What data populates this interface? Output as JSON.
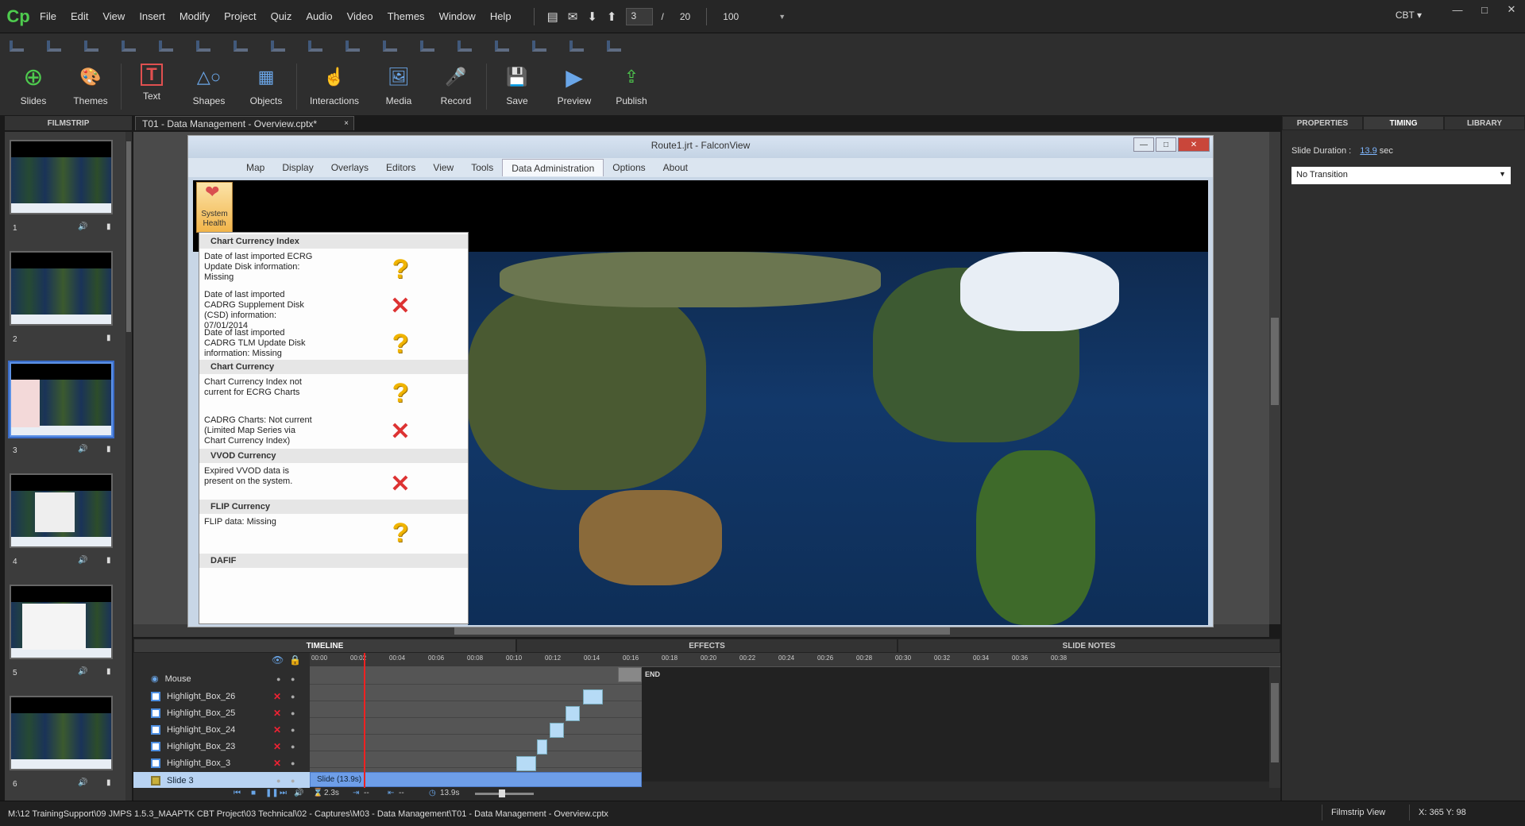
{
  "menubar": {
    "logo": "Cp",
    "items": [
      "File",
      "Edit",
      "View",
      "Insert",
      "Modify",
      "Project",
      "Quiz",
      "Audio",
      "Video",
      "Themes",
      "Window",
      "Help"
    ],
    "current_slide": "3",
    "slide_sep": "/",
    "total_slides": "20",
    "zoom": "100",
    "workspace": "CBT"
  },
  "ribbon": {
    "buttons": [
      {
        "label": "Slides",
        "icon": "plus-circle-icon"
      },
      {
        "label": "Themes",
        "icon": "palette-icon"
      },
      {
        "label": "Text",
        "icon": "text-t-icon"
      },
      {
        "label": "Shapes",
        "icon": "shapes-icon"
      },
      {
        "label": "Objects",
        "icon": "objects-icon"
      },
      {
        "label": "Interactions",
        "icon": "hand-pointer-icon"
      },
      {
        "label": "Media",
        "icon": "image-icon"
      },
      {
        "label": "Record",
        "icon": "microphone-icon"
      },
      {
        "label": "Save",
        "icon": "floppy-icon"
      },
      {
        "label": "Preview",
        "icon": "play-icon"
      },
      {
        "label": "Publish",
        "icon": "publish-icon"
      }
    ]
  },
  "filmstrip": {
    "header": "FILMSTRIP",
    "slides": [
      "1",
      "2",
      "3",
      "4",
      "5",
      "6"
    ]
  },
  "document_tab": {
    "title": "T01 - Data Management - Overview.cptx*",
    "close": "×"
  },
  "falconview": {
    "title": "Route1.jrt - FalconView",
    "tabs": [
      "Map",
      "Display",
      "Overlays",
      "Editors",
      "View",
      "Tools",
      "Data Administration",
      "Options",
      "About"
    ],
    "active_tab": "Data Administration",
    "system_health_label": "System Health",
    "popup": {
      "sections": [
        {
          "title": "Chart Currency Index"
        },
        {
          "title": "Chart Currency"
        },
        {
          "title": "VVOD Currency"
        },
        {
          "title": "FLIP Currency"
        },
        {
          "title": "DAFIF"
        }
      ],
      "items": [
        {
          "text": "Date of last imported ECRG Update Disk information: Missing",
          "status": "?"
        },
        {
          "text": "Date of last imported CADRG Supplement Disk (CSD) information:  07/01/2014",
          "status": "✕"
        },
        {
          "text": "Date of last imported CADRG TLM Update Disk information: Missing",
          "status": "?"
        },
        {
          "text": "Chart Currency Index not current for ECRG Charts",
          "status": "?"
        },
        {
          "text": "CADRG Charts: Not current (Limited Map Series via Chart Currency Index)",
          "status": "✕"
        },
        {
          "text": "Expired VVOD data is present on the system.",
          "status": "✕"
        },
        {
          "text": "FLIP data:  Missing",
          "status": "?"
        }
      ]
    }
  },
  "properties": {
    "tabs": [
      "PROPERTIES",
      "TIMING",
      "LIBRARY"
    ],
    "duration_label": "Slide Duration :",
    "duration_value": "13.9",
    "duration_unit": "sec",
    "transition": "No Transition"
  },
  "timeline": {
    "tabs": [
      "TIMELINE",
      "EFFECTS",
      "SLIDE NOTES"
    ],
    "rows": [
      {
        "name": "Mouse"
      },
      {
        "name": "Highlight_Box_26"
      },
      {
        "name": "Highlight_Box_25"
      },
      {
        "name": "Highlight_Box_24"
      },
      {
        "name": "Highlight_Box_23"
      },
      {
        "name": "Highlight_Box_3"
      },
      {
        "name": "Slide 3"
      }
    ],
    "ruler": [
      "00:00",
      "00:02",
      "00:04",
      "00:06",
      "00:08",
      "00:10",
      "00:12",
      "00:14",
      "00:16",
      "00:18",
      "00:20",
      "00:22",
      "00:24",
      "00:26",
      "00:28",
      "00:30",
      "00:32",
      "00:34",
      "00:36",
      "00:38"
    ],
    "slide_block": "Slide (13.9s)",
    "end_label": "END",
    "controls": {
      "current_time": "2.3s",
      "in_time": "--",
      "out_time": "--",
      "duration": "13.9s"
    }
  },
  "statusbar": {
    "path": "M:\\12 TrainingSupport\\09 JMPS 1.5.3_MAAPTK CBT Project\\03 Technical\\02 - Captures\\M03 - Data Management\\T01 - Data Management - Overview.cptx",
    "view": "Filmstrip View",
    "coords": "X: 365 Y: 98"
  }
}
